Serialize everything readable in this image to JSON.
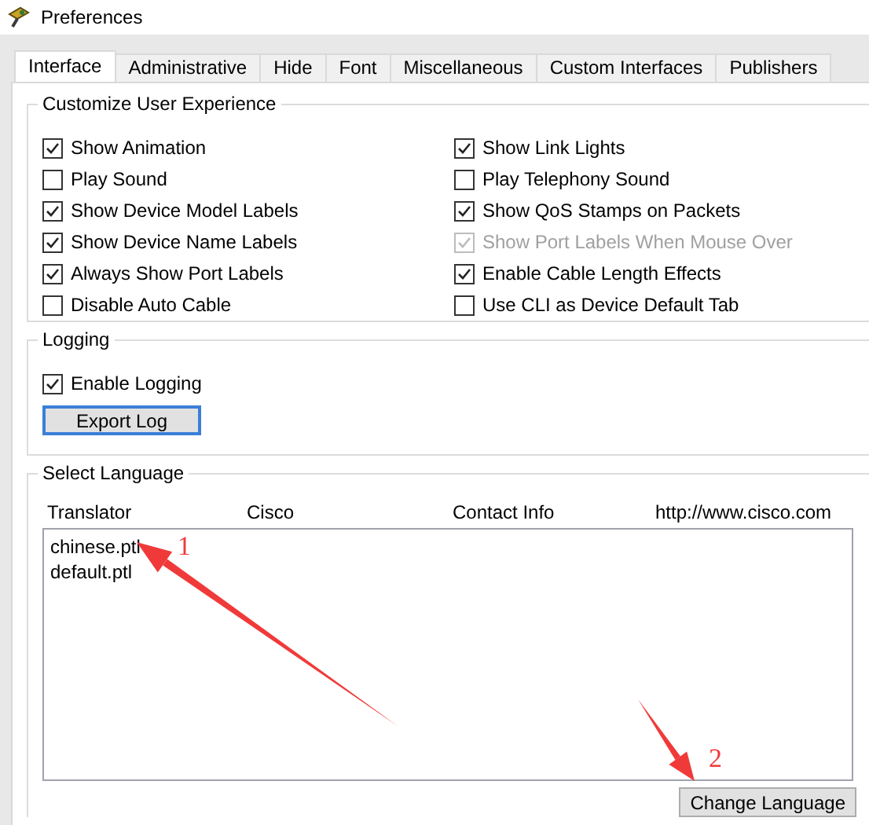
{
  "window": {
    "title": "Preferences"
  },
  "tabs": [
    {
      "label": "Interface",
      "selected": true
    },
    {
      "label": "Administrative",
      "selected": false
    },
    {
      "label": "Hide",
      "selected": false
    },
    {
      "label": "Font",
      "selected": false
    },
    {
      "label": "Miscellaneous",
      "selected": false
    },
    {
      "label": "Custom Interfaces",
      "selected": false
    },
    {
      "label": "Publishers",
      "selected": false
    }
  ],
  "customize": {
    "title": "Customize User Experience",
    "options": [
      {
        "label": "Show Animation",
        "checked": true,
        "disabled": false
      },
      {
        "label": "Show Link Lights",
        "checked": true,
        "disabled": false
      },
      {
        "label": "Play Sound",
        "checked": false,
        "disabled": false
      },
      {
        "label": "Play Telephony Sound",
        "checked": false,
        "disabled": false
      },
      {
        "label": "Show Device Model Labels",
        "checked": true,
        "disabled": false
      },
      {
        "label": "Show QoS Stamps on Packets",
        "checked": true,
        "disabled": false
      },
      {
        "label": "Show Device Name Labels",
        "checked": true,
        "disabled": false
      },
      {
        "label": "Show Port Labels When Mouse Over",
        "checked": true,
        "disabled": true
      },
      {
        "label": "Always Show Port Labels",
        "checked": true,
        "disabled": false
      },
      {
        "label": "Enable Cable Length Effects",
        "checked": true,
        "disabled": false
      },
      {
        "label": "Disable Auto Cable",
        "checked": false,
        "disabled": false
      },
      {
        "label": "Use CLI as Device Default Tab",
        "checked": false,
        "disabled": false
      }
    ]
  },
  "logging": {
    "title": "Logging",
    "option": {
      "label": "Enable Logging",
      "checked": true
    },
    "button": "Export Log"
  },
  "language": {
    "title": "Select Language",
    "info": [
      "Translator",
      "Cisco",
      "Contact Info",
      "http://www.cisco.com"
    ],
    "files": [
      {
        "name": "chinese.ptl",
        "selected": false
      },
      {
        "name": "default.ptl",
        "selected": false
      }
    ],
    "button": "Change Language"
  },
  "annotations": [
    {
      "text": "1"
    },
    {
      "text": "2"
    }
  ]
}
